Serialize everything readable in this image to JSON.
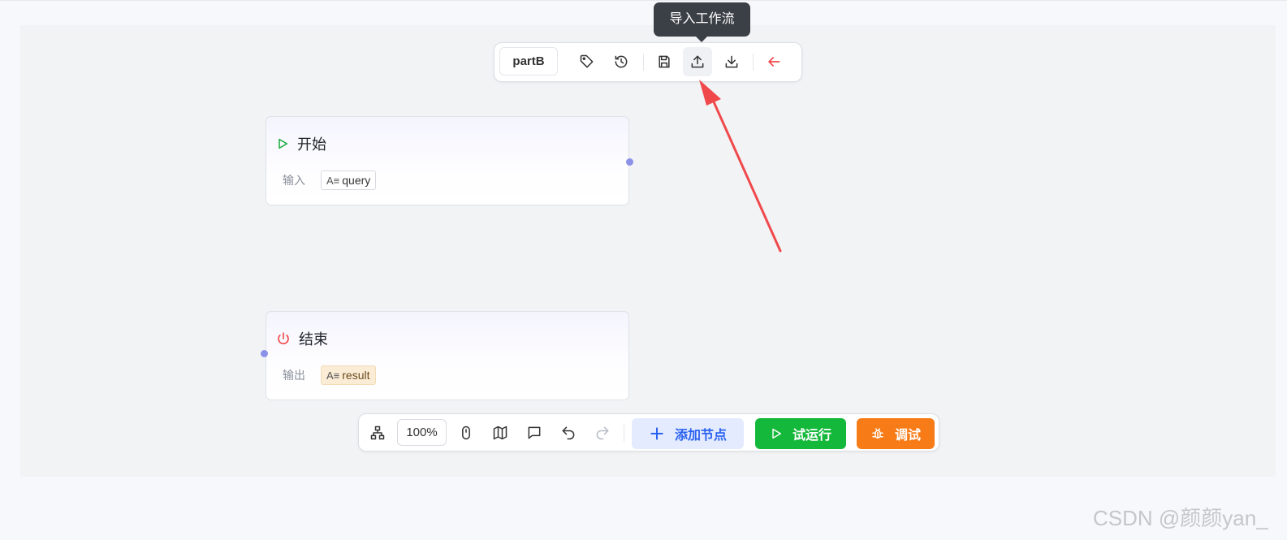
{
  "tooltip": {
    "text": "导入工作流"
  },
  "top_toolbar": {
    "workflow_name": "partB",
    "icons": [
      "tag-icon",
      "history-icon",
      "save-icon",
      "upload-icon",
      "download-icon",
      "back-arrow-icon"
    ]
  },
  "nodes": {
    "start": {
      "title": "开始",
      "row_label": "输入",
      "var_icon": "A≡",
      "var_name": "query"
    },
    "end": {
      "title": "结束",
      "row_label": "输出",
      "var_icon": "A≡",
      "var_name": "result"
    }
  },
  "bottom_toolbar": {
    "zoom": "100%",
    "add_node_label": "添加节点",
    "run_label": "试运行",
    "debug_label": "调试"
  },
  "colors": {
    "accent_blue": "#2a62f0",
    "run_green": "#14b83a",
    "debug_orange": "#f77b16",
    "annotation_red": "#f0494c",
    "handle_purple": "#8b91e8"
  },
  "watermark": "CSDN @颜颜yan_"
}
